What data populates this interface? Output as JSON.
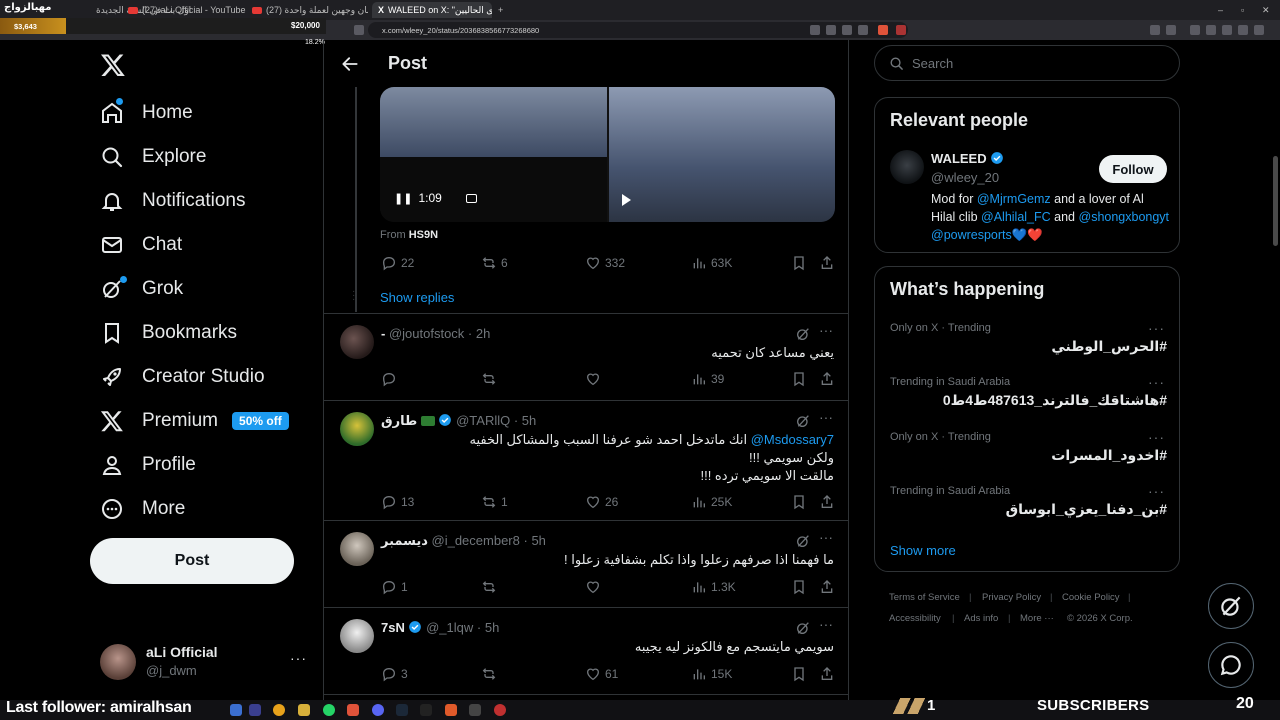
{
  "browser": {
    "tabs": [
      {
        "label": "اول بث في السنة الجديدة"
      },
      {
        "label": "(27) aLi Official - YouTube"
      },
      {
        "label": "(27) الحواجز ويالمان وجهين لعملة واحدة"
      },
      {
        "label": "WALEED on X: \"المحتوى الحاليين\""
      }
    ],
    "url": "x.com/wleey_20/status/2036838566773268680"
  },
  "stream_overlay": {
    "title": "مهبالزواج",
    "gold_amount": "$3,643",
    "goal_amount": "$20,000",
    "goal_percent": "18.2%",
    "last_follower": "Last follower: amiralhsan",
    "subscribers_count": "1",
    "subscribers_label": "SUBSCRIBERS",
    "subscribers_right": "20"
  },
  "nav": {
    "items": [
      {
        "label": "Home"
      },
      {
        "label": "Explore"
      },
      {
        "label": "Notifications"
      },
      {
        "label": "Chat"
      },
      {
        "label": "Grok"
      },
      {
        "label": "Bookmarks"
      },
      {
        "label": "Creator Studio"
      },
      {
        "label": "Premium"
      },
      {
        "label": "Profile"
      },
      {
        "label": "More"
      }
    ],
    "premium_badge": "50% off",
    "post_button": "Post",
    "account": {
      "name": "aLi Official",
      "handle": "@j_dwm"
    }
  },
  "header": {
    "title": "Post"
  },
  "video": {
    "time": "1:09",
    "source_prefix": "From",
    "source_name": "HS9N"
  },
  "main_post_stats": {
    "replies": "22",
    "reposts": "6",
    "likes": "332",
    "views": "63K"
  },
  "show_replies": "Show replies",
  "replies": [
    {
      "name": "-",
      "handle": "@joutofstock",
      "time": "2h",
      "text_lines": [
        "يعني مساعد كان تحميه"
      ],
      "replies": "",
      "reposts": "",
      "likes": "",
      "views": "39"
    },
    {
      "name": "طارق",
      "handle": "@TARllQ",
      "time": "5h",
      "mention": "@Msdossary7",
      "text_lines": [
        "انك ماتدخل احمد شو عرفنا السبب والمشاكل الخفيه",
        "ولكن سويمي !!!",
        "مالقت الا سويمي ترده !!!"
      ],
      "replies": "13",
      "reposts": "1",
      "likes": "26",
      "views": "25K"
    },
    {
      "name": "ديسمبر",
      "handle": "@i_december8",
      "time": "5h",
      "text_lines": [
        "ما فهمنا اذا صرفهم زعلوا واذا تكلم بشفافية زعلوا !"
      ],
      "replies": "1",
      "reposts": "",
      "likes": "",
      "views": "1.3K"
    },
    {
      "name": "7sN",
      "handle": "@_1lqw",
      "time": "5h",
      "text_lines": [
        "سويمي مايتسجم مع فالكونز ليه يجيبه"
      ],
      "replies": "3",
      "reposts": "",
      "likes": "61",
      "views": "15K"
    }
  ],
  "search": {
    "placeholder": "Search"
  },
  "relevant_people": {
    "title": "Relevant people",
    "name": "WALEED",
    "handle": "@wleey_20",
    "follow": "Follow",
    "bio_prefix": "Mod for ",
    "bio_mention1": "@MjrmGemz",
    "bio_mid": " and a lover of Al Hilal clib ",
    "bio_mention2": "@Alhilal_FC",
    "bio_and": " and",
    "bio_mention3": "@shongxbongyt",
    "bio_mention4": "@powresports",
    "bio_hearts": "💙❤️"
  },
  "happening": {
    "title": "What’s happening",
    "trends": [
      {
        "category": "Only on X · Trending",
        "name": "#الحرس_الوطني"
      },
      {
        "category": "Trending in Saudi Arabia",
        "name": "#هاشتاقك_فالترند_487613ط4ط0"
      },
      {
        "category": "Only on X · Trending",
        "name": "#اخدود_المسرات"
      },
      {
        "category": "Trending in Saudi Arabia",
        "name": "#بن_دفنا_يعزي_ابوساق"
      }
    ],
    "show_more": "Show more"
  },
  "footer": {
    "links": [
      "Terms of Service",
      "Privacy Policy",
      "Cookie Policy",
      "Accessibility",
      "Ads info",
      "More ···",
      "© 2026 X Corp."
    ]
  },
  "colors": {
    "accent": "#1d9bf0",
    "background": "#000000",
    "border": "#2f3336",
    "muted": "#71767b"
  }
}
